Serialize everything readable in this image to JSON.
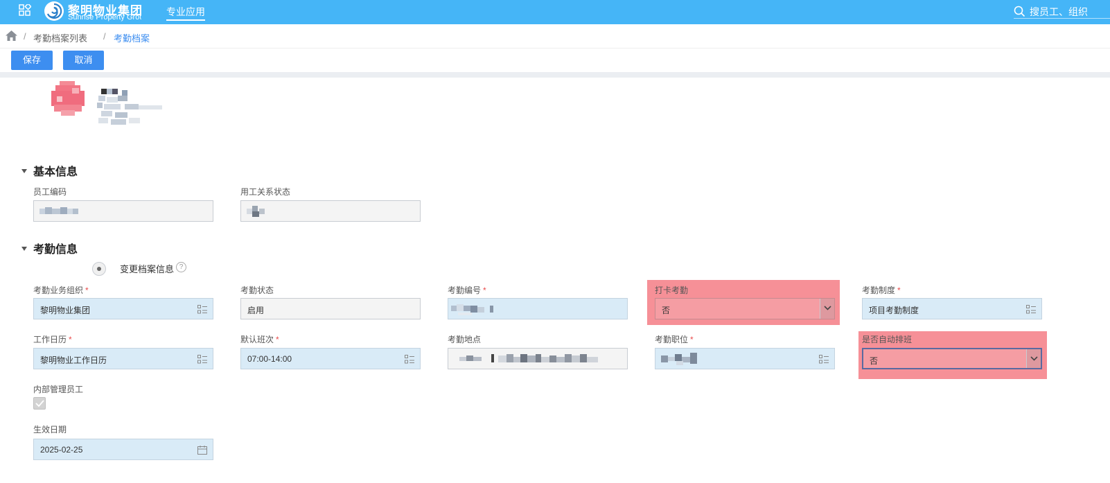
{
  "header": {
    "logo_cn": "黎明物业集团",
    "logo_en": "Sunrise Property Group",
    "nav_item": "专业应用",
    "search_placeholder": "搜员工、组织"
  },
  "breadcrumb": {
    "items": [
      "考勤档案列表",
      "考勤档案"
    ]
  },
  "toolbar": {
    "save_label": "保存",
    "cancel_label": "取消"
  },
  "sections": {
    "basic": {
      "title": "基本信息",
      "fields": {
        "employee_code": {
          "label": "员工编码"
        },
        "employment_status": {
          "label": "用工关系状态"
        }
      }
    },
    "attendance": {
      "title": "考勤信息",
      "change_option": "变更档案信息",
      "fields": {
        "business_org": {
          "label": "考勤业务组织",
          "value": "黎明物业集团",
          "required": "*"
        },
        "status": {
          "label": "考勤状态",
          "value": "启用"
        },
        "code": {
          "label": "考勤编号",
          "required": "*"
        },
        "clock_in": {
          "label": "打卡考勤",
          "value": "否"
        },
        "policy": {
          "label": "考勤制度",
          "value": "项目考勤制度",
          "required": "*"
        },
        "work_calendar": {
          "label": "工作日历",
          "value": "黎明物业工作日历",
          "required": "*"
        },
        "default_shift": {
          "label": "默认班次",
          "value": "07:00-14:00",
          "required": "*"
        },
        "location": {
          "label": "考勤地点"
        },
        "position": {
          "label": "考勤职位",
          "required": "*"
        },
        "auto_schedule": {
          "label": "是否自动排班",
          "value": "否"
        },
        "internal_staff": {
          "label": "内部管理员工"
        },
        "effective_date": {
          "label": "生效日期",
          "value": "2025-02-25"
        }
      }
    }
  },
  "colors": {
    "header_bg": "#45b5f7",
    "button_bg": "#3d8ef0",
    "highlight": "#f47880",
    "required": "#e94b4b"
  }
}
